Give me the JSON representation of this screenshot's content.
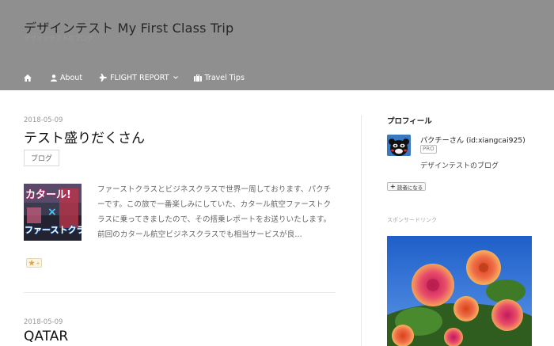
{
  "site": {
    "title": "デザインテスト My First Class Trip",
    "description": "デザインテストのブログ"
  },
  "nav": {
    "home_icon": "home-icon",
    "items": [
      {
        "label": "About",
        "icon": "person-icon"
      },
      {
        "label": "FLIGHT REPORT",
        "icon": "airplane-icon",
        "dropdown": true
      },
      {
        "label": "Travel Tips",
        "icon": "suitcase-icon"
      }
    ]
  },
  "posts": [
    {
      "date": "2018-05-09",
      "title": "テスト盛りだくさん",
      "category": "ブログ",
      "thumbnail_text": [
        "カタール!",
        "×",
        "ファーストクラ"
      ],
      "excerpt": "ファーストクラスとビジネスクラスで世界一周しております、パクチーです。この旅で一番楽しみにしていた、カタール航空ファーストクラスに乗ってきましたので、その搭乗レポートをお送りいたします。 前回のカタール航空ビジネスクラスでも相当サービスが良…",
      "star_icon": "star-icon"
    },
    {
      "date": "2018-05-09",
      "title": "QATAR"
    }
  ],
  "sidebar": {
    "profile_heading": "プロフィール",
    "profile_name": "パクチーさん (id:xiangcai925)",
    "pro_badge": "PRO",
    "profile_desc": "デザインテストのブログ",
    "reader_button": "読者になる",
    "sponsor_label": "スポンサードリンク"
  },
  "colors": {
    "header_bg": "#8f8f8f",
    "text_dark": "#111111",
    "text_muted": "#999999"
  }
}
